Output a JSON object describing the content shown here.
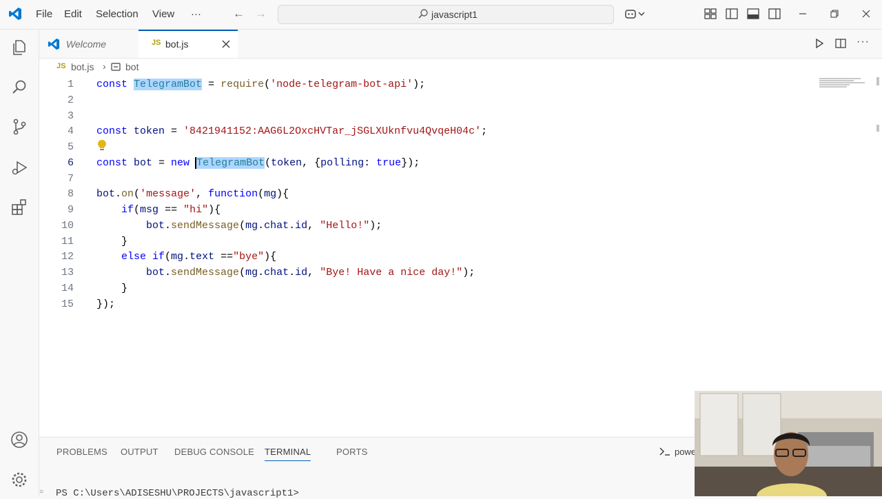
{
  "menu": {
    "file": "File",
    "edit": "Edit",
    "selection": "Selection",
    "view": "View",
    "more": "···"
  },
  "search": {
    "text": "javascript1"
  },
  "tabs": [
    {
      "label": "Welcome"
    },
    {
      "label": "bot.js",
      "badge": "JS"
    }
  ],
  "breadcrumb": {
    "file_badge": "JS",
    "file": "bot.js",
    "separator": "›",
    "symbol": "bot"
  },
  "editor": {
    "line_numbers": [
      "1",
      "2",
      "3",
      "4",
      "5",
      "6",
      "7",
      "8",
      "9",
      "10",
      "11",
      "12",
      "13",
      "14",
      "15"
    ],
    "current_line": "6",
    "lines": [
      [
        [
          "kw",
          "const "
        ],
        [
          "cls hl",
          "TelegramBot"
        ],
        [
          "plain",
          " = "
        ],
        [
          "fn",
          "require"
        ],
        [
          "plain",
          "("
        ],
        [
          "str",
          "'node-telegram-bot-api'"
        ],
        [
          "plain",
          ");"
        ]
      ],
      [],
      [],
      [
        [
          "kw",
          "const "
        ],
        [
          "var",
          "token"
        ],
        [
          "plain",
          " = "
        ],
        [
          "str",
          "'8421941152:AAG6L2OxcHVTar_jSGLXUknfvu4QvqeH04c'"
        ],
        [
          "plain",
          ";"
        ]
      ],
      [],
      [
        [
          "kw",
          "const "
        ],
        [
          "var",
          "bot"
        ],
        [
          "plain",
          " = "
        ],
        [
          "kw",
          "new "
        ],
        [
          "cls hl cursor",
          "TelegramBot"
        ],
        [
          "plain",
          "("
        ],
        [
          "var",
          "token"
        ],
        [
          "plain",
          ", {"
        ],
        [
          "var",
          "polling"
        ],
        [
          "plain",
          ": "
        ],
        [
          "kw",
          "true"
        ],
        [
          "plain",
          "});"
        ]
      ],
      [],
      [
        [
          "var",
          "bot"
        ],
        [
          "plain",
          "."
        ],
        [
          "fn",
          "on"
        ],
        [
          "plain",
          "("
        ],
        [
          "str",
          "'message'"
        ],
        [
          "plain",
          ", "
        ],
        [
          "kw",
          "function"
        ],
        [
          "plain",
          "("
        ],
        [
          "var",
          "mg"
        ],
        [
          "plain",
          "){"
        ]
      ],
      [
        [
          "plain",
          "    "
        ],
        [
          "kw",
          "if"
        ],
        [
          "plain",
          "("
        ],
        [
          "var",
          "msg"
        ],
        [
          "plain",
          " == "
        ],
        [
          "str",
          "\"hi\""
        ],
        [
          "plain",
          "){"
        ]
      ],
      [
        [
          "plain",
          "        "
        ],
        [
          "var",
          "bot"
        ],
        [
          "plain",
          "."
        ],
        [
          "fn",
          "sendMessage"
        ],
        [
          "plain",
          "("
        ],
        [
          "var",
          "mg"
        ],
        [
          "plain",
          "."
        ],
        [
          "var",
          "chat"
        ],
        [
          "plain",
          "."
        ],
        [
          "var",
          "id"
        ],
        [
          "plain",
          ", "
        ],
        [
          "str",
          "\"Hello!\""
        ],
        [
          "plain",
          ");"
        ]
      ],
      [
        [
          "plain",
          "    }"
        ]
      ],
      [
        [
          "plain",
          "    "
        ],
        [
          "kw",
          "else if"
        ],
        [
          "plain",
          "("
        ],
        [
          "var",
          "mg"
        ],
        [
          "plain",
          "."
        ],
        [
          "var",
          "text"
        ],
        [
          "plain",
          " =="
        ],
        [
          "str",
          "\"bye\""
        ],
        [
          "plain",
          "){"
        ]
      ],
      [
        [
          "plain",
          "        "
        ],
        [
          "var",
          "bot"
        ],
        [
          "plain",
          "."
        ],
        [
          "fn",
          "sendMessage"
        ],
        [
          "plain",
          "("
        ],
        [
          "var",
          "mg"
        ],
        [
          "plain",
          "."
        ],
        [
          "var",
          "chat"
        ],
        [
          "plain",
          "."
        ],
        [
          "var",
          "id"
        ],
        [
          "plain",
          ", "
        ],
        [
          "str",
          "\"Bye! Have a nice day!\""
        ],
        [
          "plain",
          ");"
        ]
      ],
      [
        [
          "plain",
          "    }"
        ]
      ],
      [
        [
          "plain",
          "});"
        ]
      ]
    ]
  },
  "panel": {
    "tabs": [
      "PROBLEMS",
      "OUTPUT",
      "DEBUG CONSOLE",
      "TERMINAL",
      "PORTS"
    ],
    "active_tab": "TERMINAL",
    "terminal_name": "powe",
    "terminal_prompt": "PS C:\\Users\\ADISESHU\\PROJECTS\\javascript1>"
  },
  "colors": {
    "accent": "#005fb8",
    "keyword": "#0000ff",
    "string": "#a31515",
    "function": "#795e26",
    "class": "#267f99",
    "variable": "#001080"
  },
  "icons": [
    "vscode-logo-icon",
    "back-arrow-icon",
    "forward-arrow-icon",
    "search-icon",
    "copilot-icon",
    "layout-icon",
    "sidebar-left-icon",
    "panel-icon",
    "sidebar-right-icon",
    "minimize-icon",
    "restore-icon",
    "close-icon",
    "explorer-icon",
    "search-view-icon",
    "source-control-icon",
    "run-debug-icon",
    "extensions-icon",
    "account-icon",
    "settings-gear-icon",
    "run-icon",
    "split-editor-icon",
    "lightbulb-icon"
  ]
}
